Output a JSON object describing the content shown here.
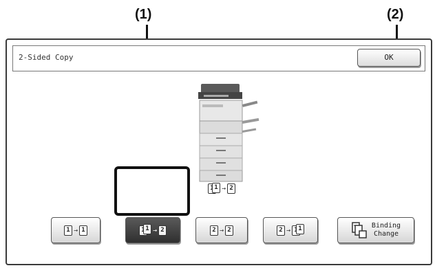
{
  "callouts": [
    "(1)",
    "(2)"
  ],
  "window": {
    "title": "2-Sided Copy",
    "ok_label": "OK"
  },
  "current_mode": {
    "front": "1",
    "back": "1",
    "result": "2"
  },
  "mode_buttons": [
    {
      "id": "1-to-1",
      "from": [
        "1"
      ],
      "to": [
        "1"
      ],
      "selected": false
    },
    {
      "id": "1-to-2",
      "from": [
        "1",
        "1"
      ],
      "to": [
        "2"
      ],
      "selected": true
    },
    {
      "id": "2-to-2",
      "from": [
        "2"
      ],
      "to": [
        "2"
      ],
      "selected": false
    },
    {
      "id": "2-to-1",
      "from": [
        "2"
      ],
      "to": [
        "1",
        "1"
      ],
      "selected": false
    }
  ],
  "binding_change": {
    "line1": "Binding",
    "line2": "Change"
  },
  "icons": {
    "copier": "copier-icon",
    "arrow": "arrow-right"
  }
}
